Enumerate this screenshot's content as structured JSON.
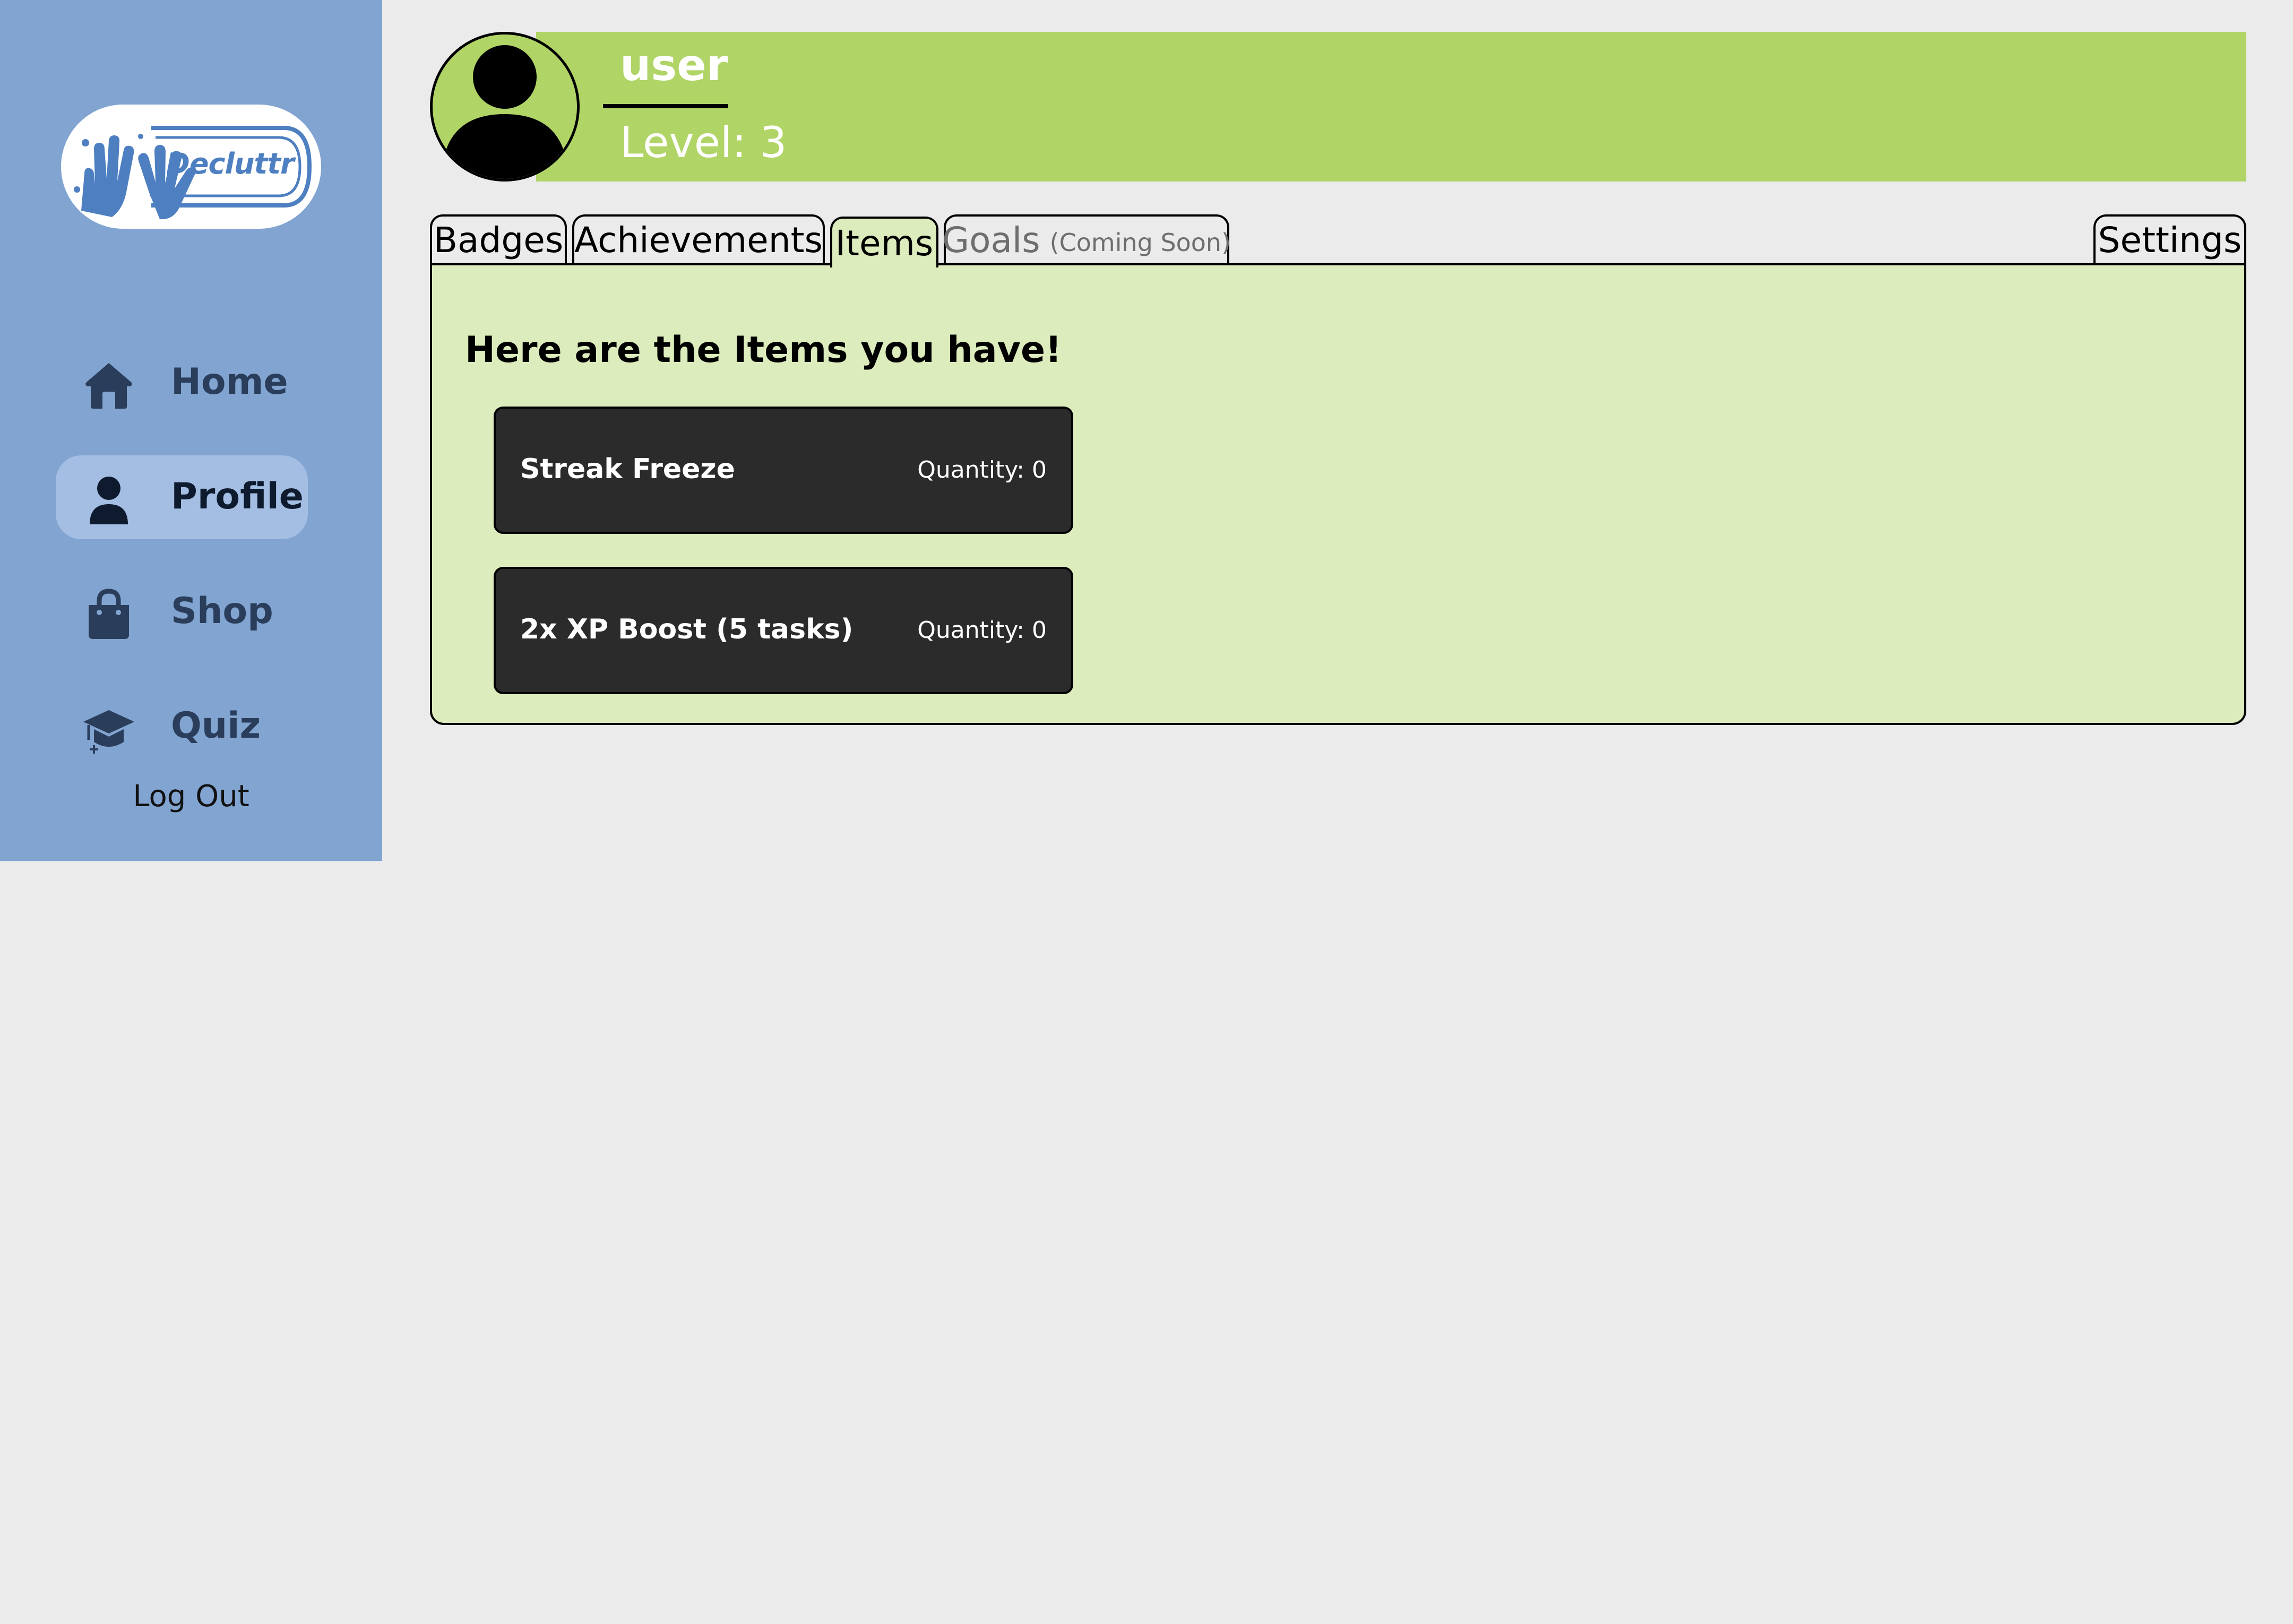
{
  "sidebar": {
    "logo_text": "Decluttr",
    "nav": [
      {
        "label": "Home",
        "icon": "home-icon",
        "active": false
      },
      {
        "label": "Profile",
        "icon": "user-icon",
        "active": true
      },
      {
        "label": "Shop",
        "icon": "shopping-bag-icon",
        "active": false
      },
      {
        "label": "Quiz",
        "icon": "graduation-cap-icon",
        "active": false
      }
    ],
    "logout_label": "Log Out"
  },
  "profile": {
    "username": "user",
    "level_text": "Level: 3",
    "avatar_icon": "avatar-silhouette-icon"
  },
  "tabs": {
    "badges": "Badges",
    "achievements": "Achievements",
    "items": "Items",
    "goals": "Goals",
    "goals_note": "(Coming Soon)",
    "settings": "Settings",
    "active": "Items"
  },
  "items_panel": {
    "heading": "Here are the Items you have!",
    "items": [
      {
        "name": "Streak Freeze",
        "quantity": "Quantity: 0"
      },
      {
        "name": "2x XP Boost (5 tasks)",
        "quantity": "Quantity: 0"
      }
    ]
  },
  "colors": {
    "sidebar_bg": "#81a4d1",
    "nav_active_bg": "#a3bee2",
    "header_bg": "#b0d466",
    "panel_bg": "#dcecbc",
    "card_bg": "#2b2b2b",
    "page_bg": "#ebebeb",
    "logo_blue": "#4d7fc1"
  }
}
